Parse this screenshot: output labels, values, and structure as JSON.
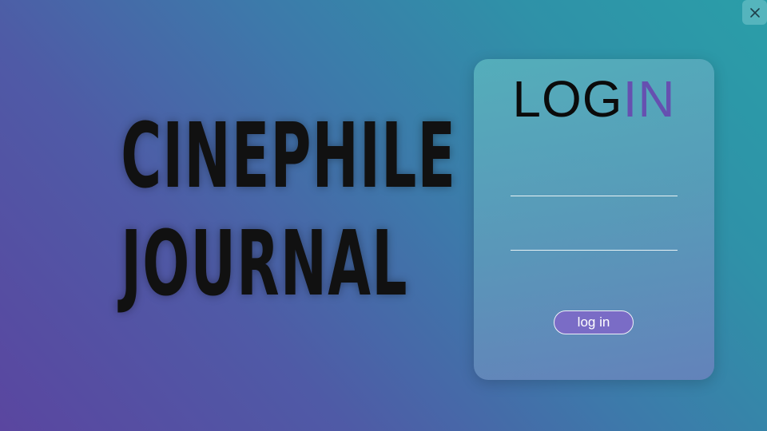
{
  "window": {
    "close_icon": "close-icon"
  },
  "brand": {
    "line1": "CINEPHILE",
    "line2": "JOURNAL"
  },
  "login": {
    "title_part1": "LOG",
    "title_part2": "IN",
    "username_value": "",
    "password_value": "",
    "button_label": "log in"
  },
  "colors": {
    "accent": "#6650b0",
    "button_bg": "#7a6cc6",
    "bg_start": "#5a46a0",
    "bg_end": "#2a9ea8"
  }
}
